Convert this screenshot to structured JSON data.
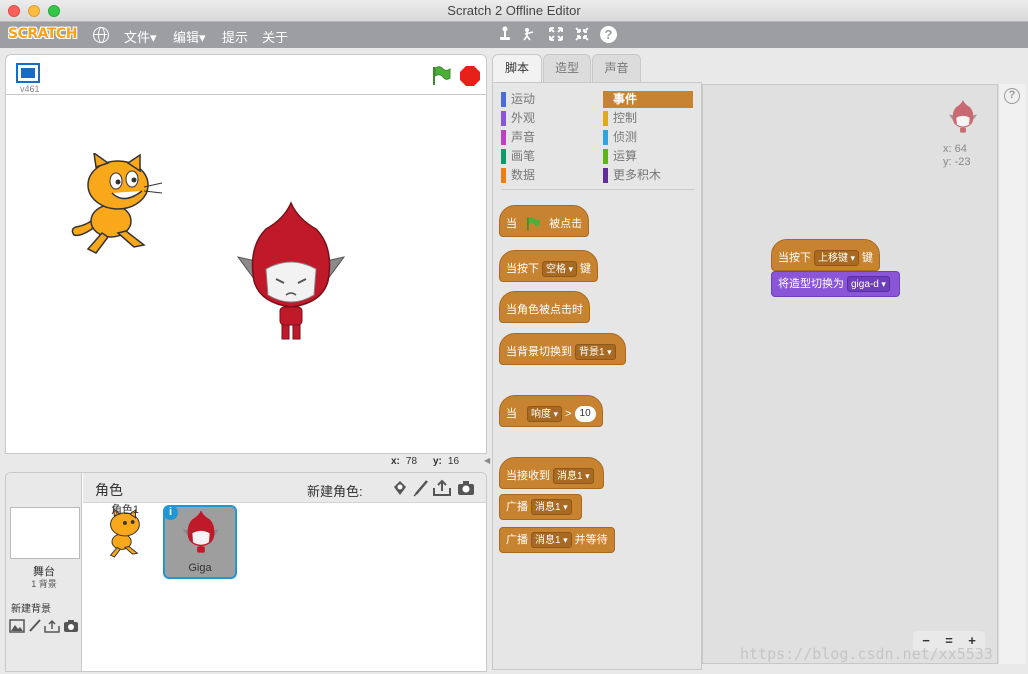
{
  "window": {
    "title": "Scratch 2 Offline Editor"
  },
  "menubar": {
    "logo": "SCRATCH",
    "items": [
      "文件▾",
      "编辑▾",
      "提示",
      "关于"
    ],
    "tool_icons": [
      "duplicate-icon",
      "cut-icon",
      "grow-icon",
      "shrink-icon",
      "help-icon"
    ],
    "help_label": "?"
  },
  "stage": {
    "version": "v461",
    "mouse_x_label": "x:",
    "mouse_x": "78",
    "mouse_y_label": "y:",
    "mouse_y": "16"
  },
  "sprites_panel": {
    "title": "角色",
    "new_sprite_label": "新建角色:",
    "stage_label": "舞台",
    "stage_backdrops": "1 背景",
    "new_backdrop_label": "新建背景",
    "sprites": [
      {
        "name": "角色1"
      },
      {
        "name": "Giga",
        "selected": true
      }
    ],
    "info_badge": "i"
  },
  "tabs": [
    "脚本",
    "造型",
    "声音"
  ],
  "palette": {
    "categories_left": [
      {
        "label": "运动",
        "color": "#4a6cd4"
      },
      {
        "label": "外观",
        "color": "#8a55d7"
      },
      {
        "label": "声音",
        "color": "#bb42c3"
      },
      {
        "label": "画笔",
        "color": "#0e9a6c"
      },
      {
        "label": "数据",
        "color": "#ee7d16"
      }
    ],
    "categories_right": [
      {
        "label": "事件",
        "color": "#c88330",
        "active": true
      },
      {
        "label": "控制",
        "color": "#e1a91a"
      },
      {
        "label": "侦测",
        "color": "#2ca5e2"
      },
      {
        "label": "运算",
        "color": "#5cb712"
      },
      {
        "label": "更多积木",
        "color": "#632d99"
      }
    ],
    "blocks": {
      "when_flag_1": "当",
      "when_flag_2": "被点击",
      "when_key_1": "当按下",
      "when_key_dd": "空格",
      "when_key_2": "键",
      "when_sprite_clicked": "当角色被点击时",
      "when_backdrop_1": "当背景切换到",
      "when_backdrop_dd": "背景1",
      "when_loudness_1": "当",
      "when_loudness_dd": "响度",
      "when_loudness_op": ">",
      "when_loudness_val": "10",
      "when_receive_1": "当接收到",
      "when_receive_dd": "消息1",
      "broadcast_1": "广播",
      "broadcast_dd": "消息1",
      "broadcast_wait_1": "广播",
      "broadcast_wait_dd": "消息1",
      "broadcast_wait_2": "并等待"
    }
  },
  "script_area": {
    "sprite_x": "x: 64",
    "sprite_y": "y: -23",
    "script": {
      "hat_1": "当按下",
      "hat_dd": "上移键",
      "hat_2": "键",
      "switch_1": "将造型切换为",
      "switch_dd": "giga-d"
    },
    "zoom": [
      "−",
      "=",
      "+"
    ]
  },
  "watermark": "https://blog.csdn.net/xx5533",
  "colors": {
    "events": "#c88330",
    "looks": "#8a55d7",
    "menubar": "#9c9ea2",
    "selection": "#2196d4"
  }
}
